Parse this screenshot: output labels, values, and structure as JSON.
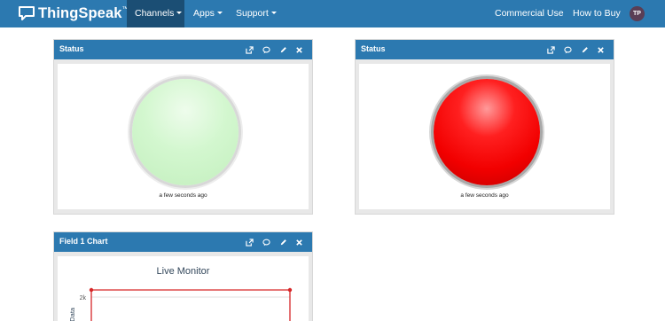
{
  "app": {
    "brand": "ThingSpeak",
    "brand_tm": "™",
    "accent_color": "#2c79b0"
  },
  "nav": {
    "channels": "Channels",
    "apps": "Apps",
    "support": "Support",
    "commercial_use": "Commercial Use",
    "how_to_buy": "How to Buy",
    "avatar_initials": "TP"
  },
  "widgets": [
    {
      "title": "Status",
      "timestamp": "a few seconds ago",
      "lamp_state": "off",
      "lamp_color": "#ccf7c9",
      "icons": [
        "external-link-icon",
        "comment-icon",
        "pencil-icon",
        "close-icon"
      ]
    },
    {
      "title": "Status",
      "timestamp": "a few seconds ago",
      "lamp_state": "on",
      "lamp_color": "#ff0000",
      "icons": [
        "external-link-icon",
        "comment-icon",
        "pencil-icon",
        "close-icon"
      ]
    },
    {
      "title": "Field 1 Chart",
      "icons": [
        "external-link-icon",
        "comment-icon",
        "pencil-icon",
        "close-icon"
      ]
    }
  ],
  "chart_data": {
    "type": "line",
    "title": "Live Monitor",
    "ylabel_visible": "n Data",
    "y_ticks": [
      "2k"
    ],
    "series": [
      {
        "values": [
          2200,
          2200
        ],
        "color": "#d62728"
      }
    ],
    "grid": true
  }
}
